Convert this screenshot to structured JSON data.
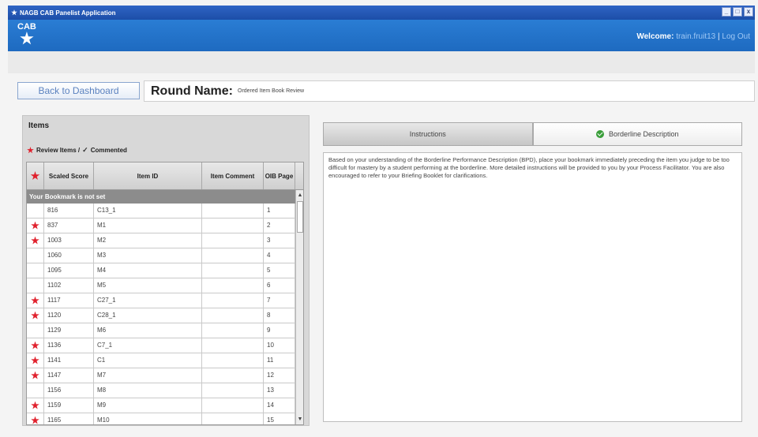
{
  "window": {
    "title": "NAGB CAB Panelist Application",
    "buttons": [
      "_",
      "□",
      "x"
    ]
  },
  "header": {
    "logo_text": "CAB",
    "welcome_label": "Welcome:",
    "username": "train.fruit13",
    "separator": "|",
    "logout": "Log Out"
  },
  "toolbar": {
    "back_button": "Back to Dashboard",
    "round_label": "Round Name:",
    "round_value": "Ordered Item Book Review"
  },
  "items_panel": {
    "title": "Items",
    "legend_review": "Review Items /",
    "legend_commented": "Commented",
    "columns": [
      "",
      "Scaled Score",
      "Item ID",
      "Item Comment",
      "OIB Page"
    ],
    "bookmark_text": "Your Bookmark is not set",
    "rows": [
      {
        "star": false,
        "score": "816",
        "id": "C13_1",
        "comment": "",
        "page": "1"
      },
      {
        "star": true,
        "score": "837",
        "id": "M1",
        "comment": "",
        "page": "2"
      },
      {
        "star": true,
        "score": "1003",
        "id": "M2",
        "comment": "",
        "page": "3"
      },
      {
        "star": false,
        "score": "1060",
        "id": "M3",
        "comment": "",
        "page": "4"
      },
      {
        "star": false,
        "score": "1095",
        "id": "M4",
        "comment": "",
        "page": "5"
      },
      {
        "star": false,
        "score": "1102",
        "id": "M5",
        "comment": "",
        "page": "6"
      },
      {
        "star": true,
        "score": "1117",
        "id": "C27_1",
        "comment": "",
        "page": "7"
      },
      {
        "star": true,
        "score": "1120",
        "id": "C28_1",
        "comment": "",
        "page": "8"
      },
      {
        "star": false,
        "score": "1129",
        "id": "M6",
        "comment": "",
        "page": "9"
      },
      {
        "star": true,
        "score": "1136",
        "id": "C7_1",
        "comment": "",
        "page": "10"
      },
      {
        "star": true,
        "score": "1141",
        "id": "C1",
        "comment": "",
        "page": "11"
      },
      {
        "star": true,
        "score": "1147",
        "id": "M7",
        "comment": "",
        "page": "12"
      },
      {
        "star": false,
        "score": "1156",
        "id": "M8",
        "comment": "",
        "page": "13"
      },
      {
        "star": true,
        "score": "1159",
        "id": "M9",
        "comment": "",
        "page": "14"
      },
      {
        "star": true,
        "score": "1165",
        "id": "M10",
        "comment": "",
        "page": "15"
      }
    ]
  },
  "right_panel": {
    "tabs": [
      "Instructions",
      "Borderline Description"
    ],
    "description": "Based on your understanding of the Borderline Performance Description (BPD), place your bookmark immediately preceding the item you judge to be too difficult for mastery by a student performing at the borderline. More detailed instructions will be provided to you by your Process Facilitator. You are also encouraged to refer to your Briefing Booklet for clarifications."
  },
  "colors": {
    "header_blue": "#1e6ac0",
    "star_red": "#e0202c",
    "check_green": "#3a9e3a"
  }
}
